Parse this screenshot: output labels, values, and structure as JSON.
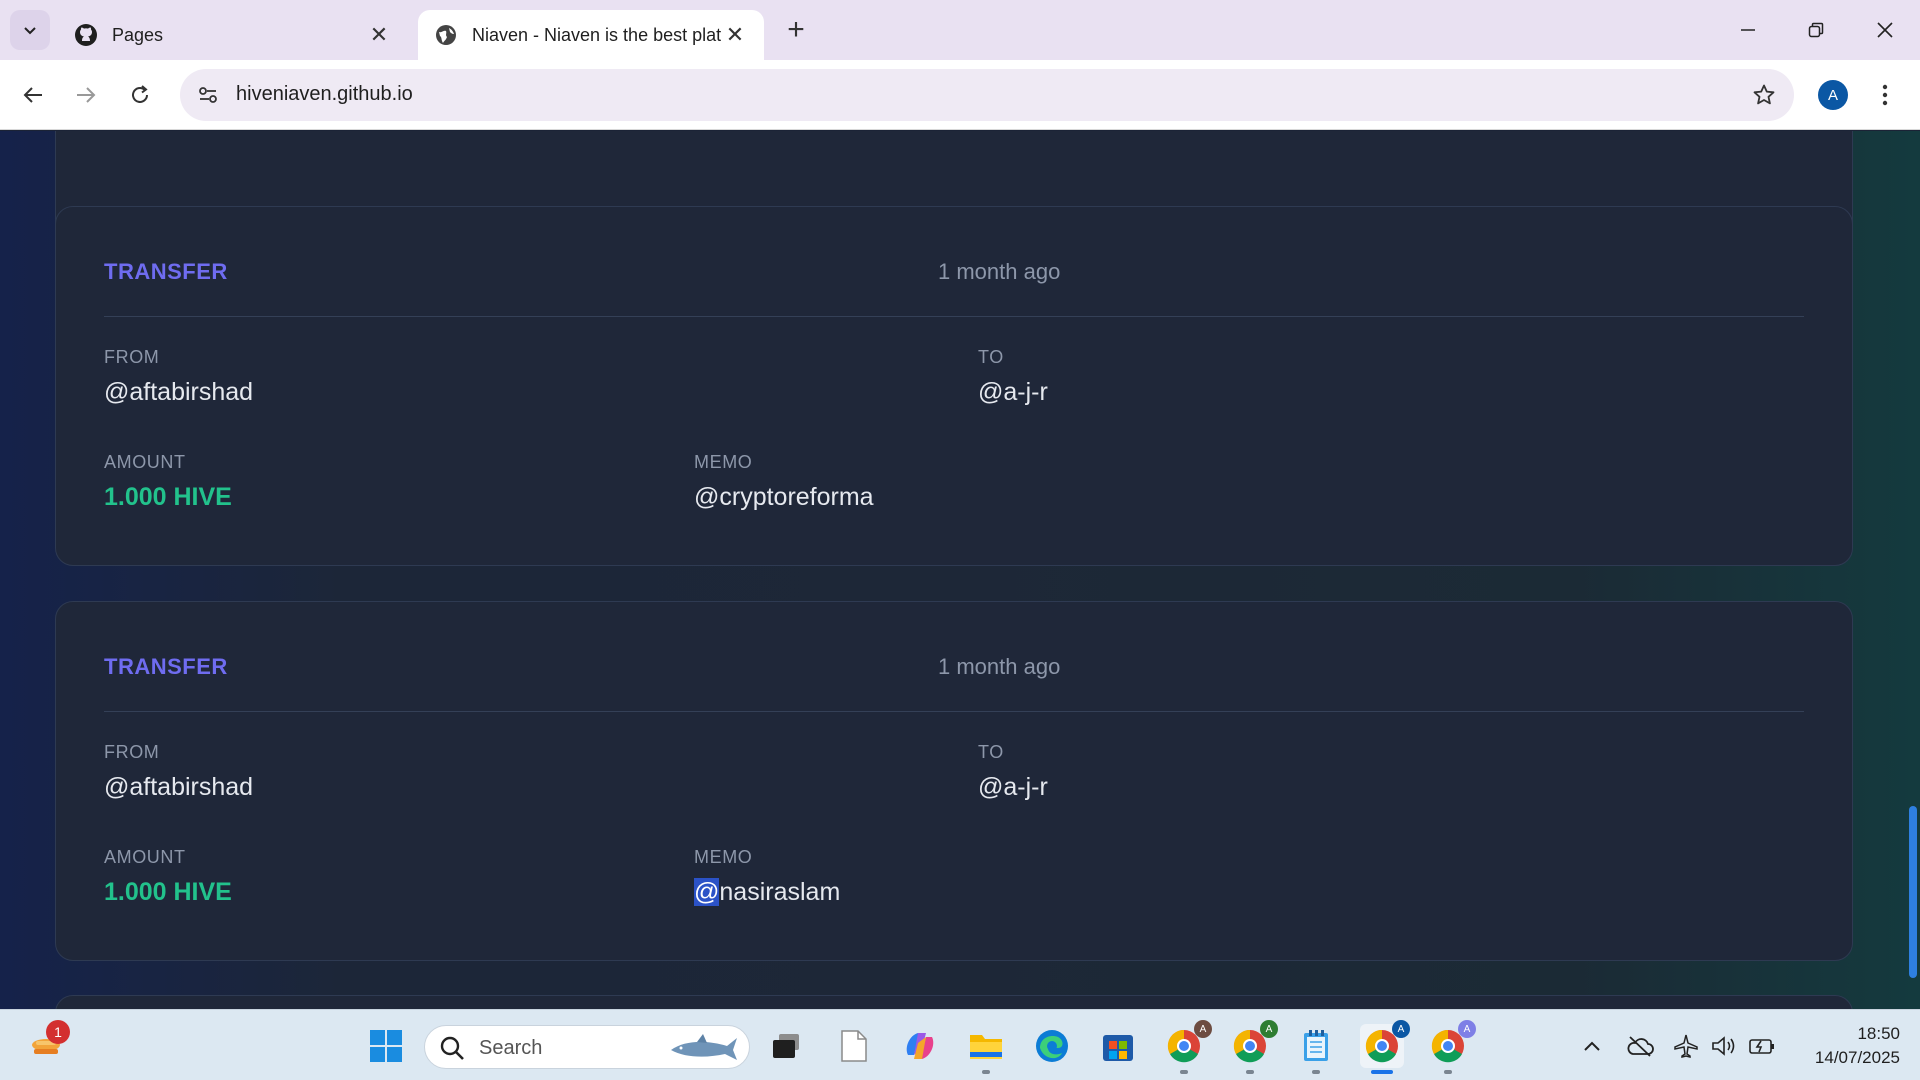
{
  "browser": {
    "tabs": [
      {
        "title": "Pages",
        "icon": "github-icon",
        "active": false
      },
      {
        "title": "Niaven - Niaven is the best plat",
        "icon": "globe-icon",
        "active": true
      }
    ],
    "url": "hiveniaven.github.io",
    "profile_initial": "A"
  },
  "operations": [
    {
      "type": "TRANSFER",
      "time": "1 month ago",
      "from_label": "FROM",
      "from": "@aftabirshad",
      "to_label": "TO",
      "to": "@a-j-r",
      "amount_label": "AMOUNT",
      "amount": "1.000 HIVE",
      "memo_label": "MEMO",
      "memo": "@cryptoreforma"
    },
    {
      "type": "TRANSFER",
      "time": "1 month ago",
      "from_label": "FROM",
      "from": "@aftabirshad",
      "to_label": "TO",
      "to": "@a-j-r",
      "amount_label": "AMOUNT",
      "amount": "1.000 HIVE",
      "memo_label": "MEMO",
      "memo_selected": "@",
      "memo_rest": "nasiraslam"
    }
  ],
  "colors": {
    "operation_type": "#6f6cf0",
    "amount": "#22c28c",
    "card_background": "#1f2739",
    "selection": "#2b52c7"
  },
  "taskbar": {
    "search_placeholder": "Search",
    "notification_count": "1",
    "chrome_profile_initials": [
      "A",
      "A",
      "A",
      "A"
    ],
    "time": "18:50",
    "date": "14/07/2025"
  }
}
